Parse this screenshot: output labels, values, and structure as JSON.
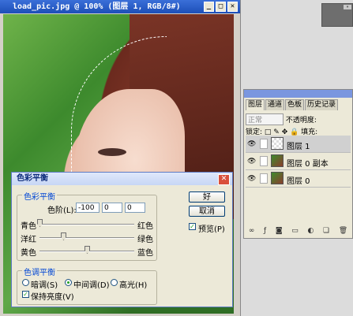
{
  "document": {
    "title": "load_pic.jpg @ 100% (图层 1, RGB/8#)",
    "min_label": "_",
    "max_label": "□",
    "close_label": "✕"
  },
  "dialog": {
    "title": "色彩平衡",
    "close_label": "✕",
    "color_balance_group": "色彩平衡",
    "levels_label": "色阶(L):",
    "levels": [
      "-100",
      "0",
      "0"
    ],
    "sliders": [
      {
        "left": "青色",
        "right": "红色",
        "value": -100
      },
      {
        "left": "洋红",
        "right": "绿色",
        "value": -50
      },
      {
        "left": "黄色",
        "right": "蓝色",
        "value": 0
      }
    ],
    "tone_group": "色调平衡",
    "tones": [
      {
        "label": "暗调(S)",
        "selected": false
      },
      {
        "label": "中间调(D)",
        "selected": true
      },
      {
        "label": "高光(H)",
        "selected": false
      }
    ],
    "preserve_label": "保持亮度(V)",
    "preserve_checked": true,
    "ok_label": "好",
    "cancel_label": "取消",
    "preview_label": "预览(P)",
    "preview_checked": true
  },
  "layers_panel": {
    "tabs": [
      "图层",
      "通道",
      "色板",
      "历史记录"
    ],
    "blend_mode": "正常",
    "opacity_label": "不透明度:",
    "lock_label": "锁定:",
    "fill_label": "填充:",
    "layers": [
      {
        "name": "图层 1",
        "selected": true
      },
      {
        "name": "图层 0 副本",
        "selected": false
      },
      {
        "name": "图层 0",
        "selected": false
      }
    ]
  },
  "colors": {
    "title_bar": "#2a5fcf",
    "accent": "#0046d5"
  }
}
